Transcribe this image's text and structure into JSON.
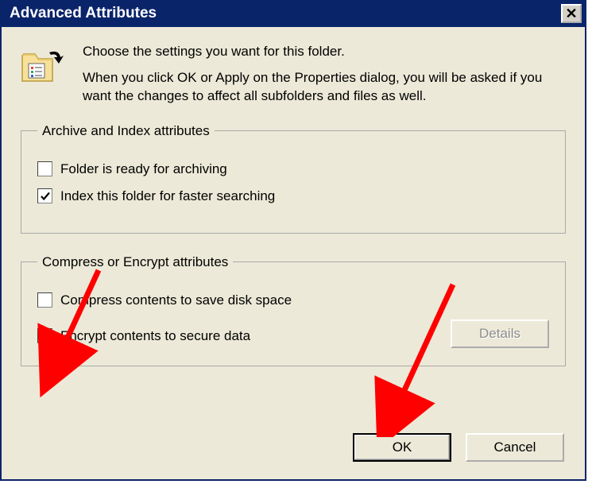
{
  "title": "Advanced Attributes",
  "intro": {
    "line1": "Choose the settings you want for this folder.",
    "line2": "When you click OK or Apply on the Properties dialog, you will be asked if you want the changes to affect all subfolders and files as well."
  },
  "group1": {
    "legend": "Archive and Index attributes",
    "archive": {
      "label": "Folder is ready for archiving",
      "checked": false
    },
    "index": {
      "label": "Index this folder for faster searching",
      "checked": true
    }
  },
  "group2": {
    "legend": "Compress or Encrypt attributes",
    "compress": {
      "label": "Compress contents to save disk space",
      "checked": false
    },
    "encrypt": {
      "label": "Encrypt contents to secure data",
      "checked": true
    }
  },
  "buttons": {
    "details": "Details",
    "ok": "OK",
    "cancel": "Cancel"
  }
}
